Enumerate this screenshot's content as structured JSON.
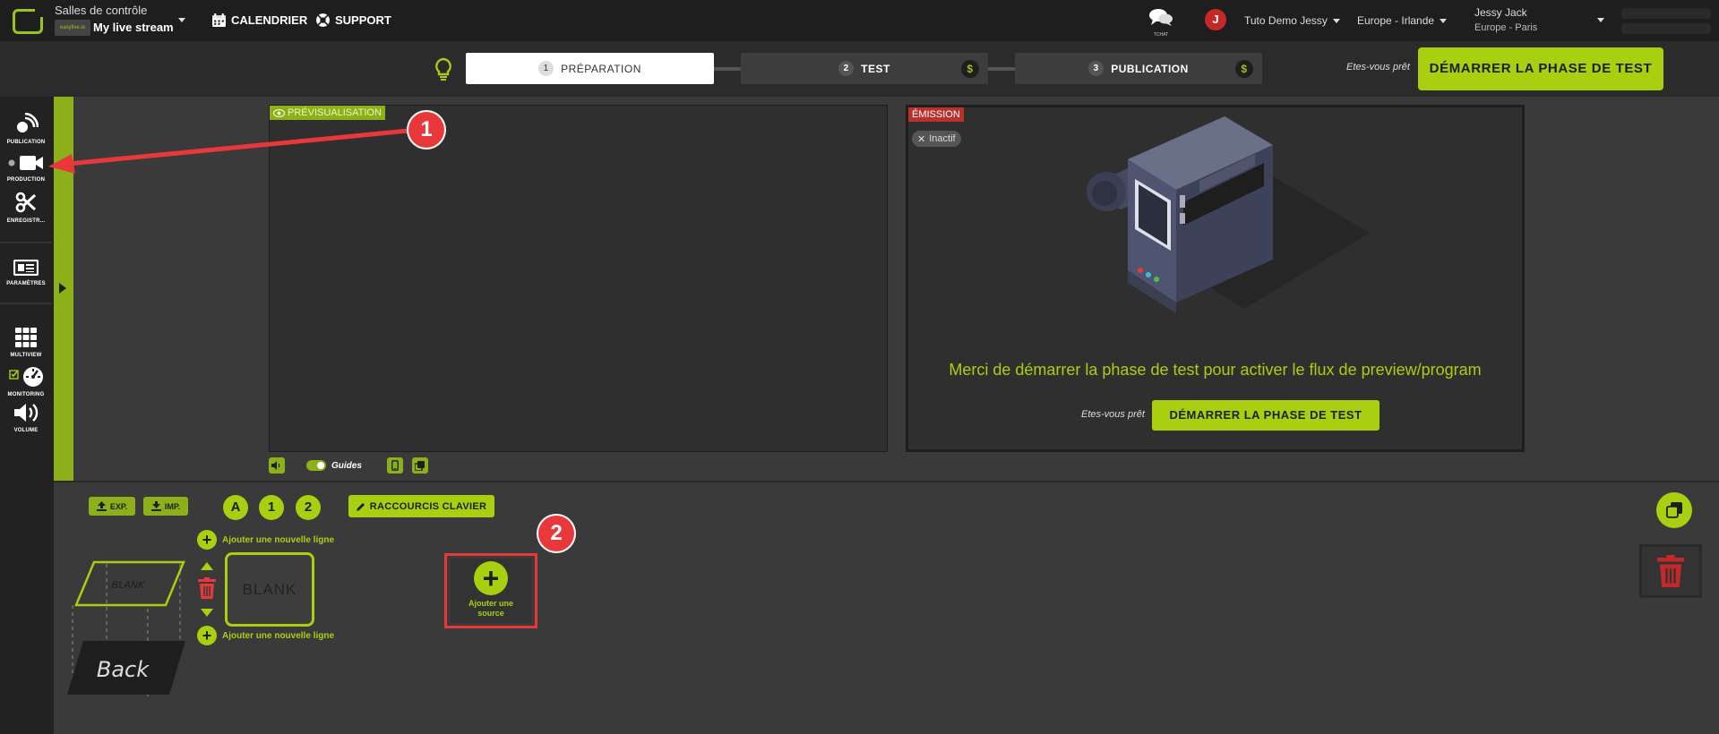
{
  "header": {
    "room_title": "Salles de contrôle",
    "brand_text": "easylive.io",
    "stream_name": "My live stream",
    "nav": {
      "calendar": "CALENDRIER",
      "support": "SUPPORT"
    },
    "tchat_label": "TCHAT",
    "avatar_initial": "J",
    "account": "Tuto Demo Jessy",
    "region": "Europe - Irlande",
    "user_name": "Jessy Jack",
    "user_zone": "Europe - Paris"
  },
  "steps": [
    {
      "num": "1",
      "label": "PRÉPARATION",
      "active": true
    },
    {
      "num": "2",
      "label": "TEST",
      "paid": "$"
    },
    {
      "num": "3",
      "label": "PUBLICATION",
      "paid": "$"
    }
  ],
  "toolbar": {
    "ready_question": "Etes-vous prêt",
    "start_test": "DÉMARRER LA PHASE DE TEST"
  },
  "sidebar": {
    "items": [
      {
        "label": "PUBLICATION",
        "icon": "broadcast-icon"
      },
      {
        "label": "PRODUCTION",
        "icon": "video-camera-icon"
      },
      {
        "label": "ENREGISTR...",
        "icon": "scissors-icon"
      },
      {
        "label": "PARAMÈTRES",
        "icon": "settings-panel-icon"
      },
      {
        "label": "MULTIVIEW",
        "icon": "grid-icon"
      },
      {
        "label": "MONITORING",
        "icon": "gauge-icon"
      },
      {
        "label": "VOLUME",
        "icon": "speaker-icon"
      }
    ]
  },
  "preview": {
    "tag": "PRÉVISUALISATION",
    "guides_label": "Guides"
  },
  "emission": {
    "tag": "ÉMISSION",
    "status": "Inactif",
    "message": "Merci de démarrer la phase de test pour activer le flux de preview/program",
    "ready_question": "Etes-vous prêt",
    "start_button": "DÉMARRER LA PHASE DE TEST"
  },
  "production": {
    "export_label": "EXP.",
    "import_label": "IMP.",
    "layers": [
      "A",
      "1",
      "2"
    ],
    "shortcuts_label": "RACCOURCIS CLAVIER",
    "add_line": "Ajouter une nouvelle ligne",
    "stage_front": "BLANK",
    "stage_back": "Back",
    "blank_card": "BLANK",
    "add_source_line1": "Ajouter une",
    "add_source_line2": "source"
  },
  "annotations": {
    "badge1": "1",
    "badge2": "2"
  },
  "colors": {
    "accent": "#a8d010",
    "alert": "#e8383a",
    "emission_tag": "#b7322d"
  }
}
